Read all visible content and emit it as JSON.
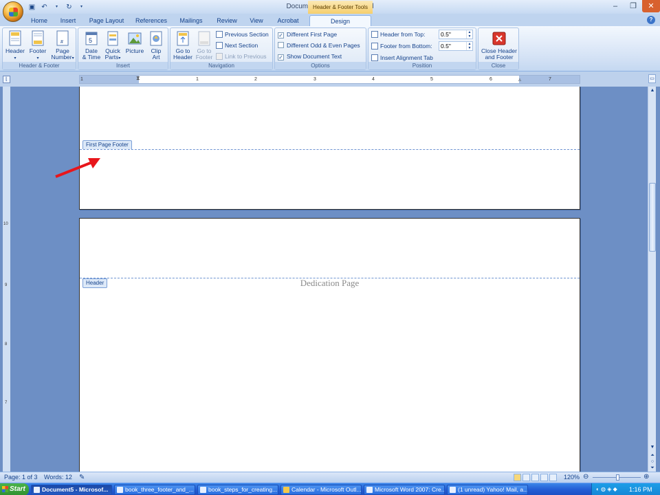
{
  "window": {
    "title": "Document5 - Microsoft Word",
    "context_title": "Header & Footer Tools"
  },
  "tabs": [
    "Home",
    "Insert",
    "Page Layout",
    "References",
    "Mailings",
    "Review",
    "View",
    "Acrobat",
    "Design"
  ],
  "active_tab": "Design",
  "ribbon": {
    "header_footer": {
      "title": "Header & Footer",
      "header": "Header",
      "footer": "Footer",
      "page_number": "Page Number"
    },
    "insert": {
      "title": "Insert",
      "date_time": "Date & Time",
      "quick_parts": "Quick Parts",
      "picture": "Picture",
      "clip_art": "Clip Art"
    },
    "navigation": {
      "title": "Navigation",
      "go_to_header": "Go to Header",
      "go_to_footer": "Go to Footer",
      "previous_section": "Previous Section",
      "next_section": "Next Section",
      "link_to_previous": "Link to Previous"
    },
    "options": {
      "title": "Options",
      "different_first_page": "Different First Page",
      "different_first_page_checked": true,
      "different_odd_even": "Different Odd & Even Pages",
      "different_odd_even_checked": false,
      "show_document_text": "Show Document Text",
      "show_document_text_checked": true
    },
    "position": {
      "title": "Position",
      "header_from_top_label": "Header from Top:",
      "header_from_top": "0.5\"",
      "footer_from_bottom_label": "Footer from Bottom:",
      "footer_from_bottom": "0.5\"",
      "insert_alignment_tab": "Insert Alignment Tab"
    },
    "close": {
      "title": "Close",
      "close_header_footer": "Close Header and Footer"
    }
  },
  "ruler": {
    "numbers": [
      "1",
      "1",
      "2",
      "3",
      "4",
      "5",
      "6",
      "7"
    ]
  },
  "vruler": {
    "numbers": [
      "10",
      "9",
      "8",
      "7"
    ]
  },
  "page1": {
    "footer_tag": "First Page Footer"
  },
  "page2": {
    "header_tag": "Header",
    "header_text": "Dedication Page"
  },
  "status": {
    "page": "Page: 1 of 3",
    "words": "Words: 12",
    "zoom": "120%"
  },
  "taskbar": {
    "start": "Start",
    "items": [
      "Document5 - Microsof...",
      "book_three_footer_and_...",
      "book_steps_for_creating...",
      "Calendar - Microsoft Outl...",
      "Microsoft Word 2007: Cre...",
      "(1 unread) Yahoo! Mail, a..."
    ],
    "active_index": 0,
    "clock": "1:16 PM"
  },
  "colors": {
    "accent": "#15428b",
    "annotation_arrow": "#e8161b"
  }
}
